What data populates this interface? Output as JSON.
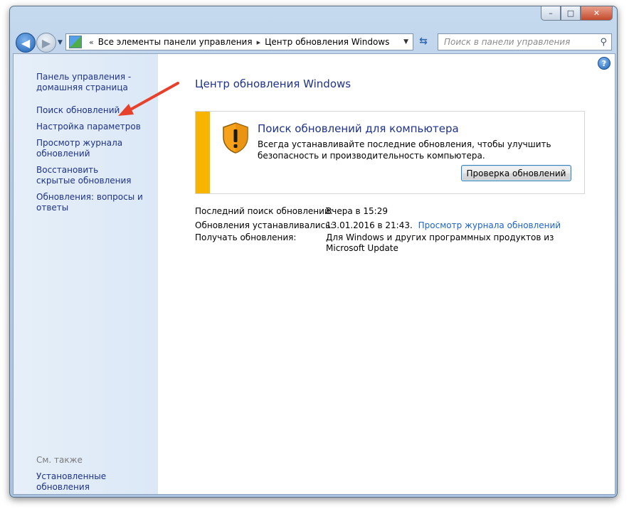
{
  "window": {
    "caption_buttons": {
      "minimize": "–",
      "maximize": "□",
      "close": "✕"
    }
  },
  "navbar": {
    "back_glyph": "◀",
    "forward_glyph": "▶",
    "breadcrumb": {
      "separator": "«",
      "item1": "Все элементы панели управления",
      "arrow": "▸",
      "item2": "Центр обновления Windows"
    },
    "search_placeholder": "Поиск в панели управления"
  },
  "sidebar": {
    "home_link": "Панель управления - домашняя страница",
    "items": [
      "Поиск обновлений",
      "Настройка параметров",
      "Просмотр журнала обновлений",
      "Восстановить скрытые обновления",
      "Обновления: вопросы и ответы"
    ],
    "see_also_header": "См. также",
    "see_also_items": [
      "Установленные обновления"
    ]
  },
  "main": {
    "title": "Центр обновления Windows",
    "panel": {
      "title": "Поиск обновлений для компьютера",
      "description": "Всегда устанавливайте последние обновления, чтобы улучшить безопасность и производительность компьютера.",
      "button": "Проверка обновлений"
    },
    "info": [
      {
        "label": "Последний поиск обновлений:",
        "value": "Вчера в 15:29"
      },
      {
        "label": "Обновления устанавливались:",
        "value": "13.01.2016 в 21:43.",
        "link": "Просмотр журнала обновлений"
      },
      {
        "label": "Получать обновления:",
        "value": "Для Windows и других программных продуктов из Microsoft Update"
      }
    ]
  },
  "colors": {
    "accent_bar": "#f7b500",
    "link": "#1e3287",
    "annotation_arrow": "#e8412b"
  }
}
